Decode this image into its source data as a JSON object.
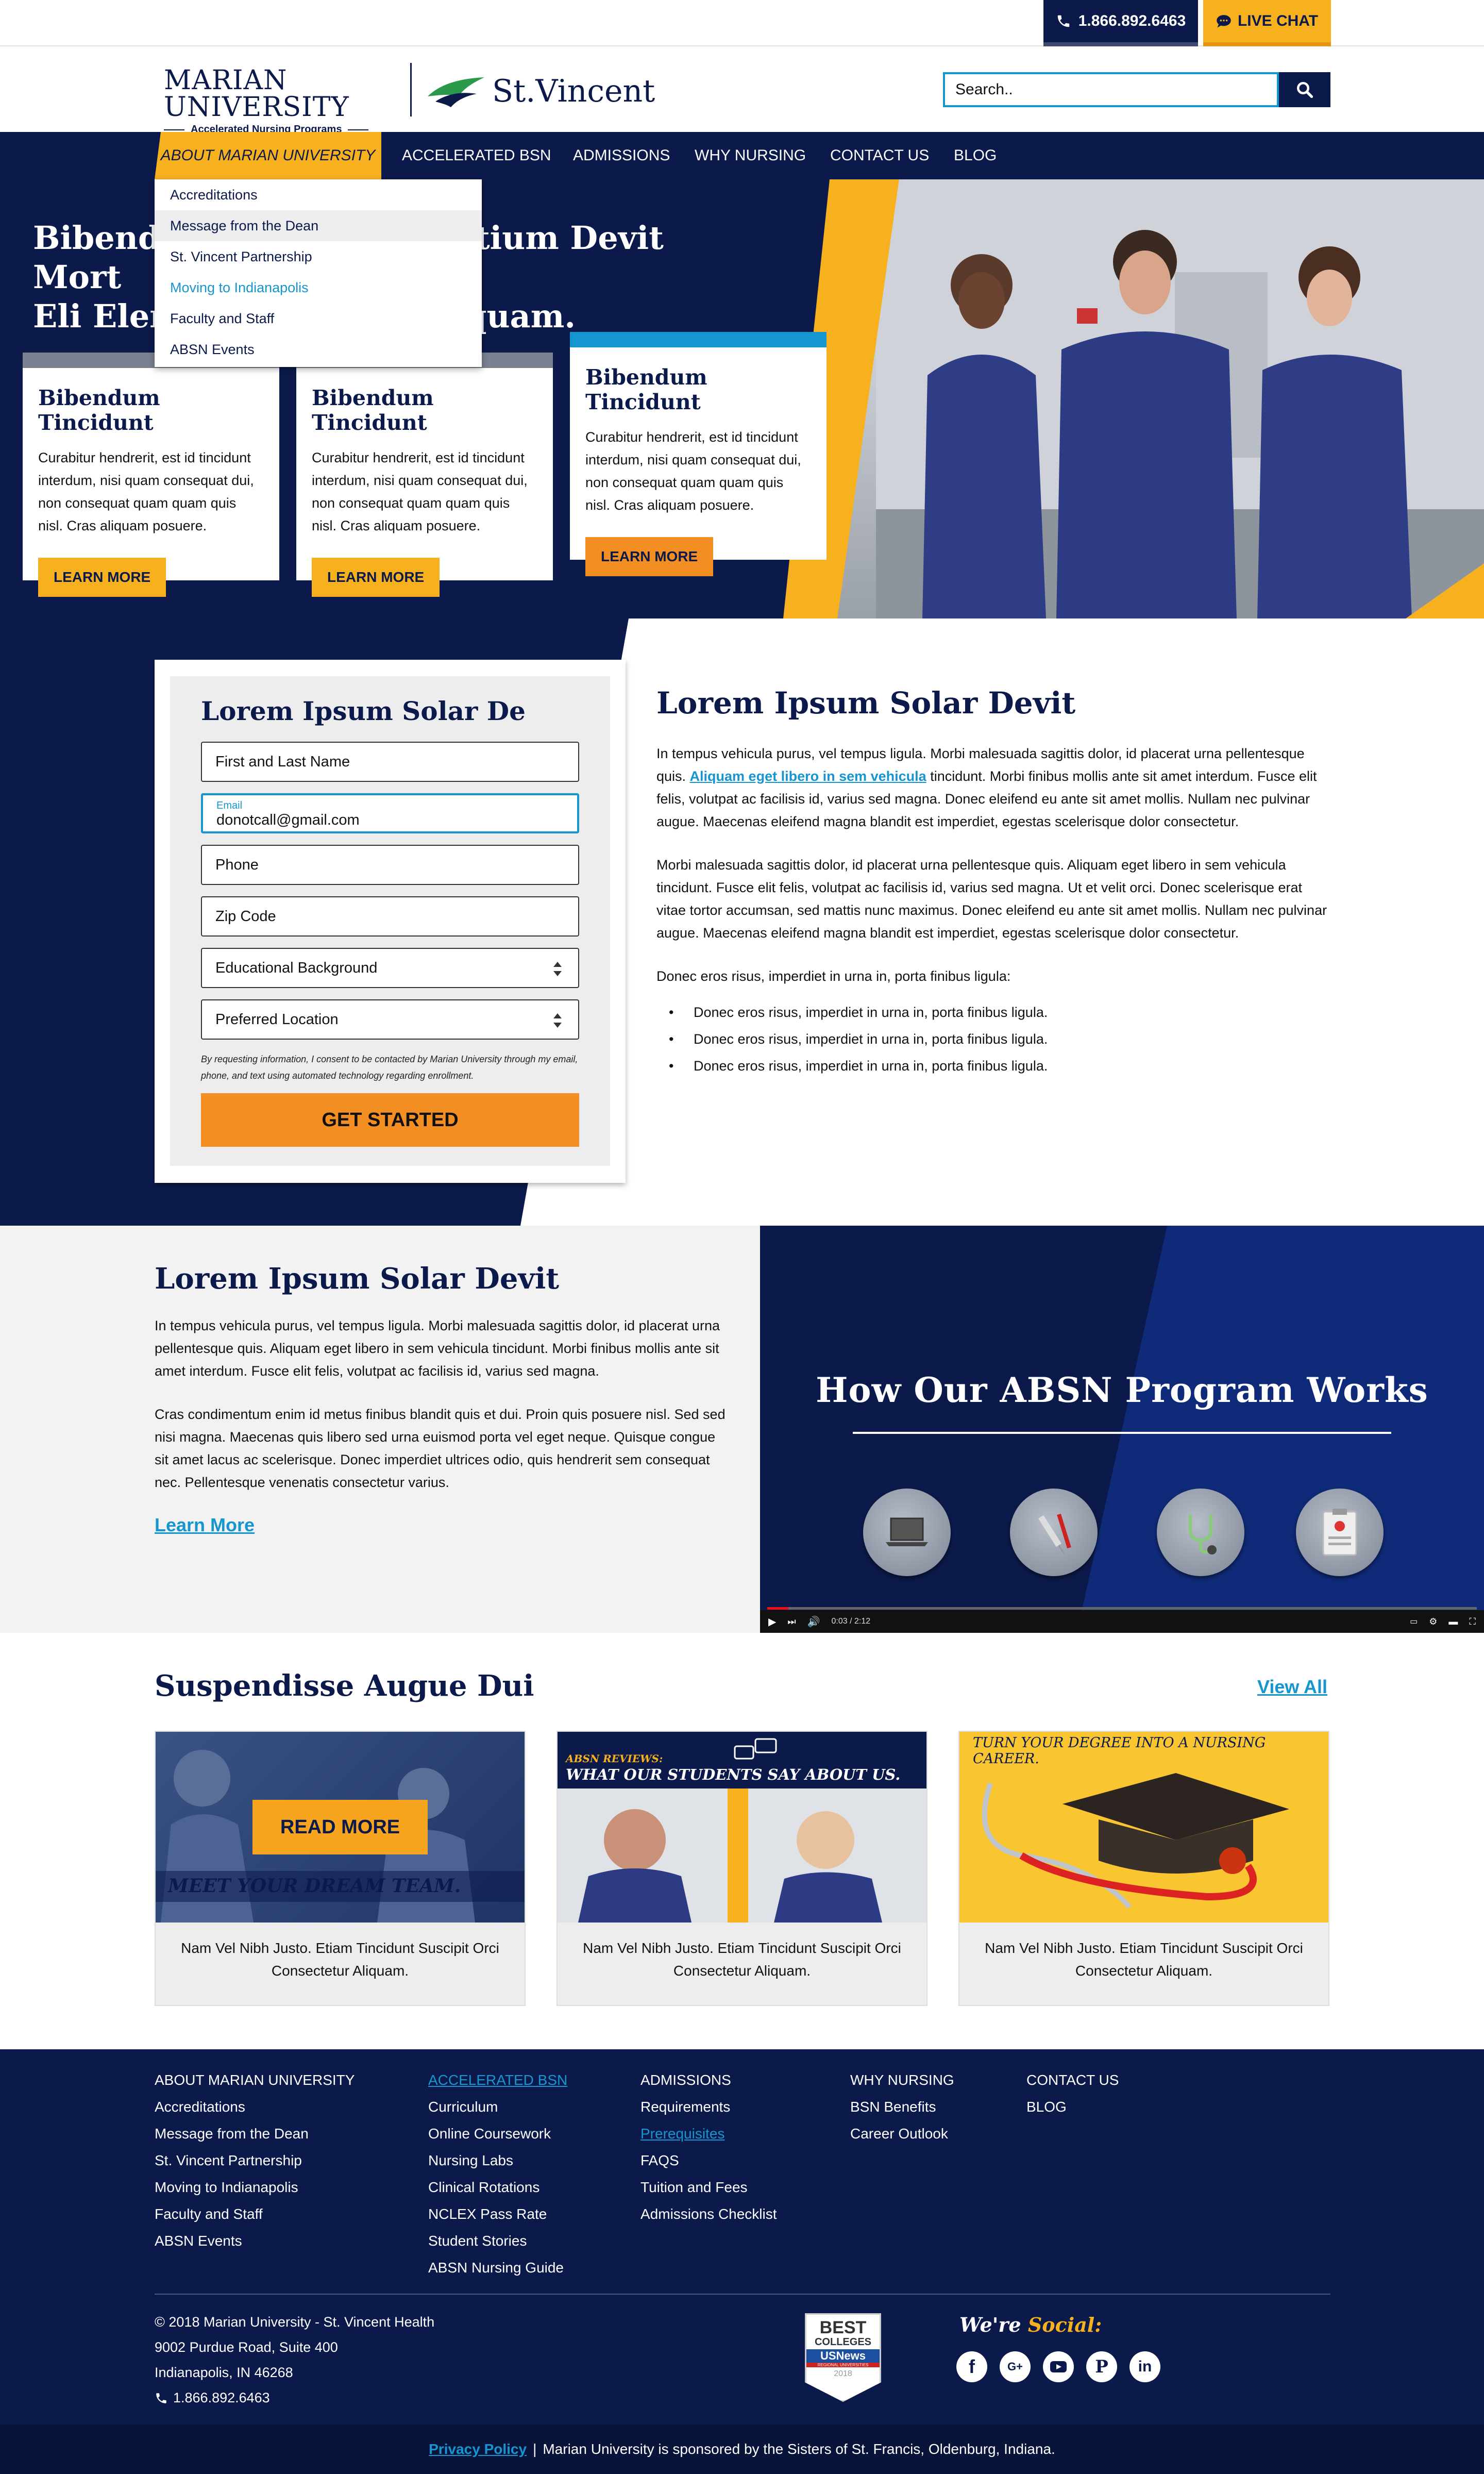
{
  "utility": {
    "phone": "1.866.892.6463",
    "chat": "LIVE CHAT"
  },
  "header": {
    "logo_marian_line1": "MARIAN UNIVERSITY",
    "logo_marian_line2": "Accelerated Nursing Programs",
    "logo_stvincent": "St.Vincent",
    "search_placeholder": "Search.."
  },
  "nav": {
    "items": [
      "ABOUT MARIAN UNIVERSITY",
      "ACCELERATED BSN",
      "ADMISSIONS",
      "WHY NURSING",
      "CONTACT US",
      "BLOG"
    ]
  },
  "dropdown": {
    "items": [
      "Accreditations",
      "Message from the Dean",
      "St. Vincent Partnership",
      "Moving to Indianapolis",
      "Faculty and Staff",
      "ABSN Events"
    ]
  },
  "hero": {
    "title_line1": "Bibendum Tincidunt Pretium Devit Mort",
    "title_line2": "Eli Elementum Diam Aliquam.",
    "cards": [
      {
        "title": "Bibendum Tincidunt",
        "body": "Curabitur hendrerit, est id tincidunt interdum, nisi quam consequat dui, non consequat quam quam quis nisl. Cras aliquam posuere.",
        "button": "LEARN MORE"
      },
      {
        "title": "Bibendum Tincidunt",
        "body": "Curabitur hendrerit, est id tincidunt interdum, nisi quam consequat dui, non consequat quam quam quis nisl. Cras aliquam posuere.",
        "button": "LEARN MORE"
      },
      {
        "title": "Bibendum Tincidunt",
        "body": "Curabitur hendrerit, est id tincidunt interdum, nisi quam consequat dui, non consequat quam quam quis nisl. Cras aliquam posuere.",
        "button": "LEARN MORE"
      }
    ]
  },
  "form": {
    "title": "Lorem Ipsum Solar De",
    "name_placeholder": "First and Last Name",
    "email_label": "Email",
    "email_value": "donotcall@gmail.com",
    "phone_placeholder": "Phone",
    "zip_placeholder": "Zip Code",
    "education_select": "Educational Background",
    "location_select": "Preferred Location",
    "consent": "By requesting information, I consent to be contacted by Marian University through my email, phone, and text using automated technology regarding enrollment.",
    "submit": "GET STARTED"
  },
  "content": {
    "title": "Lorem Ipsum Solar Devit",
    "p1_before": "In tempus vehicula purus, vel tempus ligula. Morbi malesuada sagittis dolor, id placerat urna pellentesque quis. ",
    "p1_link": "Aliquam eget libero in sem vehicula",
    "p1_after": " tincidunt. Morbi finibus mollis ante sit amet interdum. Fusce elit felis, volutpat ac facilisis id, varius sed magna. Donec eleifend eu ante sit amet mollis. Nullam nec pulvinar augue. Maecenas eleifend magna blandit est imperdiet, egestas scelerisque dolor consectetur.",
    "p2": "Morbi malesuada sagittis dolor, id placerat urna pellentesque quis. Aliquam eget libero in sem vehicula tincidunt. Fusce elit felis, volutpat ac facilisis id, varius sed magna. Ut et velit orci. Donec scelerisque erat vitae tortor accumsan, sed mattis nunc maximus. Donec eleifend eu ante sit amet mollis. Nullam nec pulvinar augue. Maecenas eleifend magna blandit est imperdiet, egestas scelerisque dolor consectetur.",
    "p3": "Donec eros risus, imperdiet in urna in, porta finibus ligula:",
    "bullets": [
      "Donec eros risus, imperdiet in urna in, porta finibus ligula.",
      "Donec eros risus, imperdiet in urna in, porta finibus ligula.",
      "Donec eros risus, imperdiet in urna in, porta finibus ligula."
    ]
  },
  "video_section": {
    "title": "Lorem Ipsum Solar Devit",
    "p1": "In tempus vehicula purus, vel tempus ligula. Morbi malesuada sagittis dolor, id placerat urna pellentesque quis. Aliquam eget libero in sem vehicula tincidunt. Morbi finibus mollis ante sit amet interdum. Fusce elit felis, volutpat ac facilisis id, varius sed magna.",
    "p2": "Cras condimentum enim id metus finibus blandit quis et dui. Proin quis posuere nisl. Sed sed nisi magna. Maecenas quis libero sed urna euismod porta vel eget neque. Quisque congue sit amet lacus ac scelerisque. Donec imperdiet ultrices odio, quis hendrerit sem consequat nec. Pellentesque venenatis consectetur varius.",
    "link": "Learn More",
    "video_title": "How Our ABSN Program Works",
    "video_time": "0:03 / 2:12",
    "video_progress": 0.03
  },
  "posts": {
    "title": "Suspendisse Augue Dui",
    "view_all": "View All",
    "items": [
      {
        "banner": "MEET YOUR DREAM TEAM.",
        "overlay_button": "READ MORE",
        "caption": "Nam Vel Nibh Justo. Etiam Tincidunt Suscipit Orci Consectetur Aliquam."
      },
      {
        "banner_small": "ABSN REVIEWS:",
        "banner": "WHAT OUR STUDENTS SAY ABOUT US.",
        "caption": "Nam Vel Nibh Justo. Etiam Tincidunt Suscipit Orci Consectetur Aliquam."
      },
      {
        "banner": "TURN YOUR DEGREE INTO A NURSING CAREER.",
        "caption": "Nam Vel Nibh Justo. Etiam Tincidunt Suscipit Orci Consectetur Aliquam."
      }
    ]
  },
  "footer": {
    "col1": [
      "ABOUT MARIAN UNIVERSITY",
      "Accreditations",
      "Message from the Dean",
      "St. Vincent Partnership",
      "Moving to Indianapolis",
      "Faculty and Staff",
      "ABSN Events"
    ],
    "col2": [
      "ACCELERATED BSN",
      "Curriculum",
      "Online Coursework",
      "Nursing Labs",
      "Clinical Rotations",
      "NCLEX Pass Rate",
      "Student Stories",
      "ABSN Nursing Guide"
    ],
    "col3": [
      "ADMISSIONS",
      "Requirements",
      "Prerequisites",
      "FAQS",
      "Tuition and Fees",
      "Admissions Checklist"
    ],
    "col4": [
      "WHY NURSING",
      "BSN Benefits",
      "Career Outlook"
    ],
    "col5": [
      "CONTACT US",
      "BLOG"
    ],
    "copyright": "© 2018 Marian University - St. Vincent Health",
    "address1": "9002 Purdue Road, Suite 400",
    "address2": "Indianapolis, IN 46268",
    "phone": "1.866.892.6463",
    "badge_line1": "BEST",
    "badge_line2": "COLLEGES",
    "badge_line3": "USNews",
    "badge_line4": "REGIONAL UNIVERSITIES",
    "badge_year": "2018",
    "social_prefix": "We're",
    "social_word": "Social:",
    "privacy": "Privacy Policy",
    "sponsor": "Marian University is sponsored by the Sisters of St. Francis, Oldenburg, Indiana."
  },
  "colors": {
    "navy": "#0b1a4a",
    "gold": "#f7b11e",
    "orange": "#f38f22",
    "link_blue": "#1596d1"
  }
}
